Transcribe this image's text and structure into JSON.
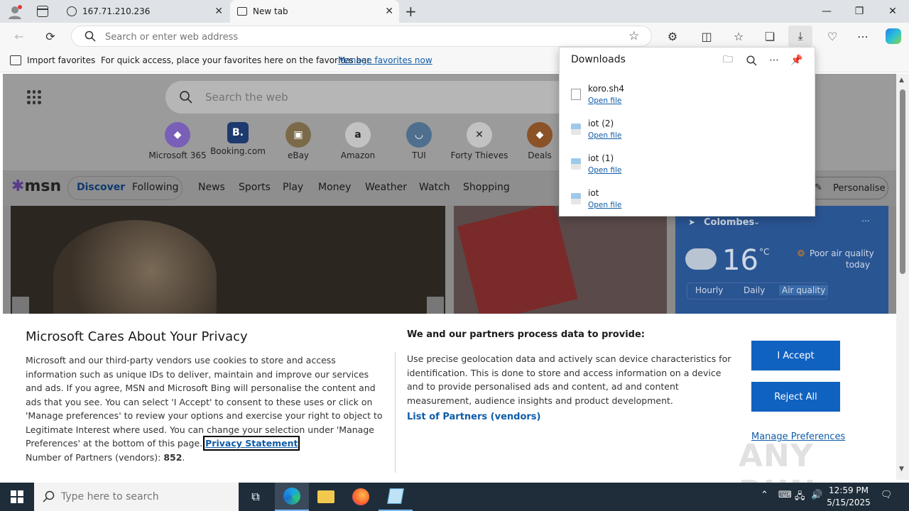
{
  "browser": {
    "tabs": [
      {
        "title": "167.71.210.236",
        "icon": "site-icon"
      },
      {
        "title": "New tab",
        "icon": "newtab-icon"
      }
    ],
    "address": {
      "placeholder": "Search or enter web address",
      "value": ""
    },
    "favorites_bar": {
      "import_label": "Import favorites",
      "hint": "For quick access, place your favorites here on the favorites bar.",
      "manage_link": "Manage favorites now"
    }
  },
  "downloads": {
    "title": "Downloads",
    "items": [
      {
        "name": "koro.sh4",
        "action": "Open file",
        "icon": "blank-file-icon"
      },
      {
        "name": "iot (2)",
        "action": "Open file",
        "icon": "app-file-icon"
      },
      {
        "name": "iot (1)",
        "action": "Open file",
        "icon": "app-file-icon"
      },
      {
        "name": "iot",
        "action": "Open file",
        "icon": "app-file-icon"
      }
    ]
  },
  "msn": {
    "search_placeholder": "Search the web",
    "quick_links": [
      {
        "label": "Microsoft 365",
        "glyph": "◆"
      },
      {
        "label": "Booking.com",
        "glyph": "B."
      },
      {
        "label": "eBay",
        "glyph": "▣"
      },
      {
        "label": "Amazon",
        "glyph": "a"
      },
      {
        "label": "TUI",
        "glyph": "◡"
      },
      {
        "label": "Forty Thieves",
        "glyph": "✕"
      },
      {
        "label": "Deals",
        "glyph": "◆"
      }
    ],
    "logo": "msn",
    "nav": [
      "Discover",
      "Following",
      "News",
      "Sports",
      "Play",
      "Money",
      "Weather",
      "Watch",
      "Shopping"
    ],
    "personalise": "Personalise",
    "weather": {
      "location": "Colombes",
      "temp": "16",
      "unit": "°C",
      "air_quality": "Poor air quality",
      "air_when": "today",
      "tabs": [
        "Hourly",
        "Daily",
        "Air quality"
      ]
    }
  },
  "privacy": {
    "title": "Microsoft Cares About Your Privacy",
    "body": "Microsoft and our third-party vendors use cookies to store and access information such as unique IDs to deliver, maintain and improve our services and ads. If you agree, MSN and Microsoft Bing will personalise the content and ads that you see. You can select 'I Accept' to consent to these uses or click on 'Manage preferences' to review your options and exercise your right to object to Legitimate Interest where used.  You can change your selection under 'Manage Preferences' at the bottom of this page.",
    "statement_link": "Privacy Statement",
    "partners_label": "Number of Partners (vendors):",
    "partners_count": "852",
    "partners_suffix": ".",
    "subtitle": "We and our partners process data to provide:",
    "purpose": "Use precise geolocation data and actively scan device characteristics for identification. This is done to store and access information on a device and to provide personalised ads and content, ad and content measurement, audience insights and product development.",
    "list_link": "List of Partners (vendors)",
    "accept": "I Accept",
    "reject": "Reject All",
    "manage": "Manage Preferences"
  },
  "watermark": "ANY RUN",
  "taskbar": {
    "search_placeholder": "Type here to search",
    "time": "12:59 PM",
    "date": "5/15/2025"
  },
  "colors": {
    "accent": "#0f62c0",
    "link": "#0f5ca8",
    "taskbar": "#1f2d3a"
  }
}
